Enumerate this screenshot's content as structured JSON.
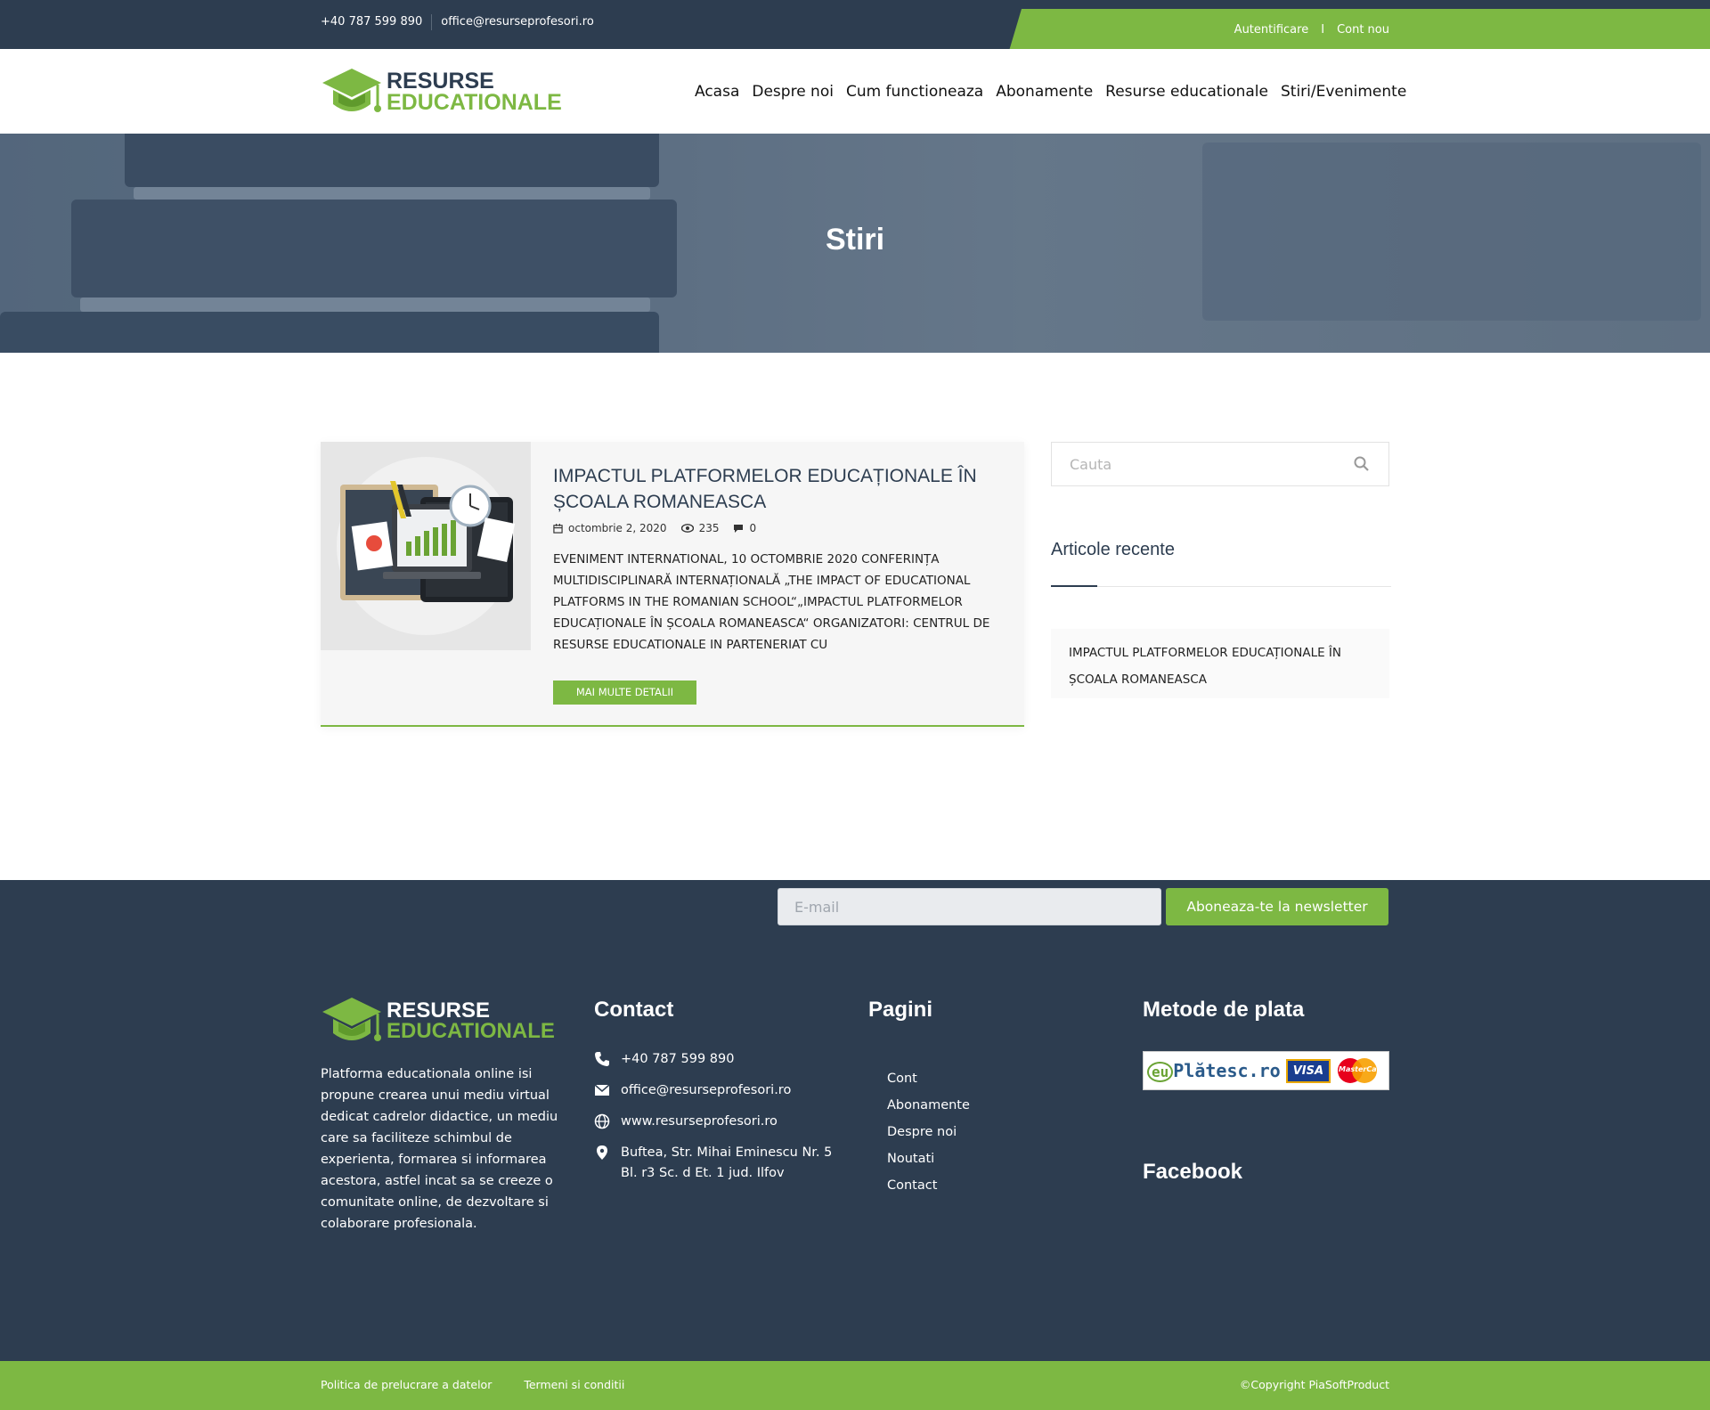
{
  "topbar": {
    "phone": "+40 787 599 890",
    "email": "office@resurseprofesori.ro",
    "login": "Autentificare",
    "divider": "I",
    "register": "Cont nou"
  },
  "brand": {
    "line1": "RESURSE",
    "line2": "EDUCATIONALE"
  },
  "nav": [
    "Acasa",
    "Despre noi",
    "Cum functioneaza",
    "Abonamente",
    "Resurse educationale",
    "Stiri/Evenimente"
  ],
  "hero": {
    "title": "Stiri"
  },
  "article": {
    "title": "IMPACTUL PLATFORMELOR EDUCAȚIONALE ÎN ȘCOALA ROMANEASCA",
    "date": "octombrie 2, 2020",
    "views": "235",
    "comments": "0",
    "excerpt": "EVENIMENT INTERNATIONAL, 10 OCTOMBRIE 2020 CONFERINȚA MULTIDISCIPLINARĂ INTERNAȚIONALĂ „THE IMPACT OF EDUCATIONAL PLATFORMS IN THE ROMANIAN SCHOOL“„IMPACTUL PLATFORMELOR EDUCAȚIONALE ÎN ȘCOALA ROMANEASCA“ ORGANIZATORI: CENTRUL DE RESURSE EDUCATIONALE IN PARTENERIAT CU",
    "more_label": "MAI MULTE DETALII"
  },
  "sidebar": {
    "search_placeholder": "Cauta",
    "recent_title": "Articole recente",
    "recent_items": [
      "IMPACTUL PLATFORMELOR EDUCAȚIONALE ÎN ȘCOALA ROMANEASCA"
    ]
  },
  "footer": {
    "newsletter_placeholder": "E-mail",
    "newsletter_button": "Aboneaza-te la newsletter",
    "about": "Platforma educationala online isi propune crearea unui mediu virtual dedicat cadrelor didactice, un mediu care sa faciliteze schimbul de experienta, formarea si informarea acestora, astfel incat sa se creeze o comunitate online, de dezvoltare si colaborare profesionala.",
    "contact_title": "Contact",
    "contact": {
      "phone": "+40 787 599 890",
      "email": "office@resurseprofesori.ro",
      "web": "www.resurseprofesori.ro",
      "address": "Buftea, Str. Mihai Eminescu Nr. 5 Bl. r3 Sc. d Et. 1 jud. Ilfov"
    },
    "pages_title": "Pagini",
    "pages": [
      "Cont",
      "Abonamente",
      "Despre noi",
      "Noutati",
      "Contact"
    ],
    "payment_title": "Metode de plata",
    "payment_logo_text": "Plătesc.ro",
    "visa": "VISA",
    "mastercard": "MasterCard",
    "facebook_title": "Facebook"
  },
  "bottom": {
    "privacy": "Politica de prelucrare a datelor",
    "terms": "Termeni si conditii",
    "copyright": "©Copyright PiaSoftProduct"
  },
  "colors": {
    "primary": "#2d3d50",
    "accent": "#7db843"
  }
}
